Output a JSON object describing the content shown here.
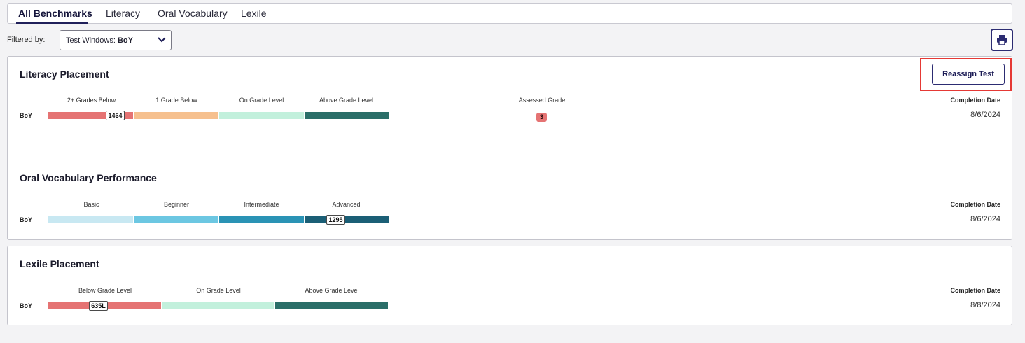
{
  "tabs": [
    {
      "label": "All Benchmarks",
      "active": true
    },
    {
      "label": "Literacy",
      "active": false
    },
    {
      "label": "Oral Vocabulary",
      "active": false
    },
    {
      "label": "Lexile",
      "active": false
    }
  ],
  "filter": {
    "label": "Filtered by:",
    "select_prefix": "Test Windows: ",
    "select_value": "BoY"
  },
  "print_icon": "printer-icon",
  "colors": {
    "accent": "#2c2c72",
    "highlight": "#e53935",
    "below2": "#e57373",
    "below1": "#f6c08e",
    "on_grade": "#c2f0dc",
    "above": "#2a6e68",
    "basic": "#c8e8f2",
    "beginner": "#6cc7e2",
    "intermediate": "#2a93b5",
    "advanced": "#1b5f76"
  },
  "literacy": {
    "title": "Literacy Placement",
    "reassign_label": "Reassign Test",
    "bands": [
      "2+ Grades Below",
      "1 Grade Below",
      "On Grade Level",
      "Above Grade Level"
    ],
    "row_label": "BoY",
    "marker_value": "1464",
    "assessed_grade_label": "Assessed Grade",
    "assessed_grade_value": "3",
    "completion_label": "Completion Date",
    "completion_value": "8/6/2024"
  },
  "oral_vocab": {
    "title": "Oral Vocabulary Performance",
    "bands": [
      "Basic",
      "Beginner",
      "Intermediate",
      "Advanced"
    ],
    "row_label": "BoY",
    "marker_value": "1295",
    "completion_label": "Completion Date",
    "completion_value": "8/6/2024"
  },
  "lexile": {
    "title": "Lexile Placement",
    "bands": [
      "Below Grade Level",
      "On Grade Level",
      "Above Grade Level"
    ],
    "row_label": "BoY",
    "marker_value": "635L",
    "completion_label": "Completion Date",
    "completion_value": "8/8/2024"
  }
}
